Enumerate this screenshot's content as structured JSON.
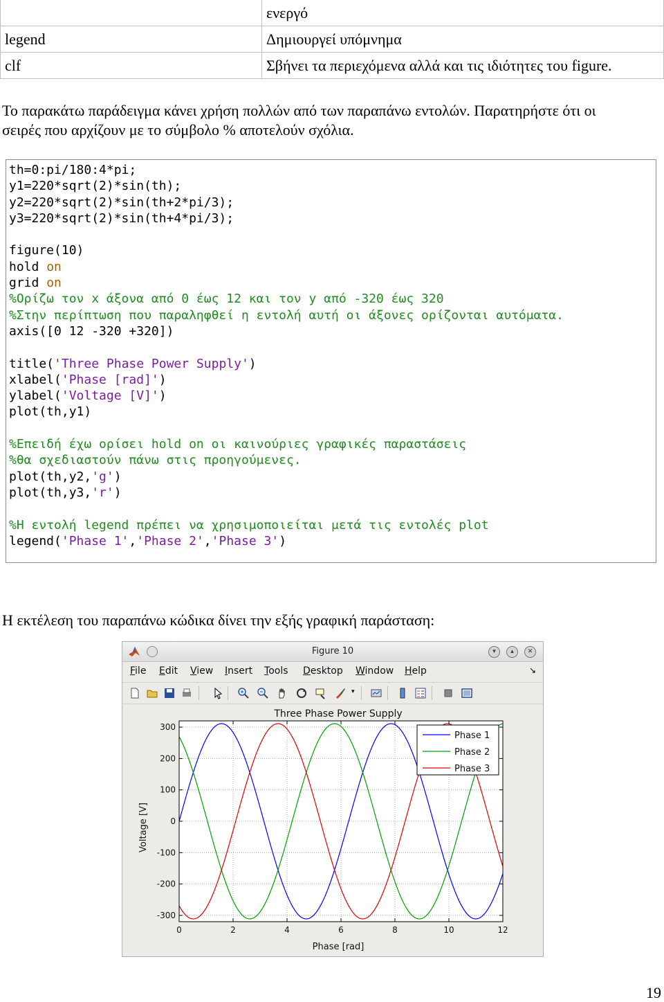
{
  "table": {
    "rows": [
      {
        "command": "",
        "description": "ενεργό"
      },
      {
        "command": "legend",
        "description": "Δημιουργεί υπόμνημα"
      },
      {
        "command": "clf",
        "description": "Σβήνει τα περιεχόμενα  αλλά και τις ιδιότητες του figure."
      }
    ]
  },
  "paragraph1_line1": "Το παρακάτω παράδειγμα κάνει χρήση πολλών από των παραπάνω εντολών. Παρατηρήστε ότι οι",
  "paragraph1_line2": "σειρές που αρχίζουν με  το σύμβολο % αποτελούν σχόλια.",
  "code": {
    "l1": "th=0:pi/180:4*pi;",
    "l2": "y1=220*sqrt(2)*sin(th);",
    "l3": "y2=220*sqrt(2)*sin(th+2*pi/3);",
    "l4": "y3=220*sqrt(2)*sin(th+4*pi/3);",
    "l5": "figure(10)",
    "hold": "hold ",
    "on": "on",
    "grid": "grid ",
    "c1": "%Ορίζω τον x άξονα από 0 έως 12 και τον y από -320 έως 320",
    "c2": "%Στην περίπτωση που παραληφθεί η εντολή αυτή οι άξονες ορίζονται αυτόματα.",
    "l6": "axis([0 12 -320 +320])",
    "title_fn": "title(",
    "title_str": "'Three Phase Power Supply'",
    "xlabel_fn": "xlabel(",
    "xlabel_str": "'Phase [rad]'",
    "ylabel_fn": "ylabel(",
    "ylabel_str": "'Voltage [V]'",
    "close": ")",
    "plot1": "plot(th,y1)",
    "c3": "%Επειδή έχω ορίσει hold on οι καινούριες γραφικές παραστάσεις",
    "c4": "%θα σχεδιαστούν πάνω στις προηγούμενες.",
    "plot2_fn": "plot(th,y2,",
    "plot2_str": "'g'",
    "plot3_fn": "plot(th,y3,",
    "plot3_str": "'r'",
    "c5": "%Η εντολή legend πρέπει να χρησιμοποιείται μετά τις εντολές plot",
    "legend_fn": "legend(",
    "leg_s1": "'Phase 1'",
    "leg_s2": "'Phase 2'",
    "leg_s3": "'Phase 3'",
    "comma": ","
  },
  "paragraph2": "Η εκτέλεση του παραπάνω κώδικα δίνει την εξής γραφική παράσταση:",
  "figure_window": {
    "title": "Figure 10",
    "menus": [
      "File",
      "Edit",
      "View",
      "Insert",
      "Tools",
      "Desktop",
      "Window",
      "Help"
    ],
    "toolbar_icons": [
      "new-file-icon",
      "open-folder-icon",
      "save-icon",
      "print-icon",
      "pointer-icon",
      "zoom-in-icon",
      "zoom-out-icon",
      "pan-icon",
      "rotate-icon",
      "data-cursor-icon",
      "brush-icon",
      "link-icon",
      "colorbar-icon",
      "legend-icon",
      "hide-tools-icon",
      "dock-icon"
    ]
  },
  "chart_data": {
    "type": "line",
    "title": "Three Phase Power Supply",
    "xlabel": "Phase [rad]",
    "ylabel": "Voltage [V]",
    "xlim": [
      0,
      12
    ],
    "ylim": [
      -320,
      320
    ],
    "xticks": [
      0,
      2,
      4,
      6,
      8,
      10,
      12
    ],
    "yticks": [
      300,
      200,
      100,
      0,
      -100,
      -200,
      -300
    ],
    "grid": true,
    "legend_position": "top-right",
    "amplitude": 311.13,
    "series": [
      {
        "name": "Phase 1",
        "color": "#0000ff",
        "phase_shift": 0
      },
      {
        "name": "Phase 2",
        "color": "#00a000",
        "phase_shift": 2.0944
      },
      {
        "name": "Phase 3",
        "color": "#e00000",
        "phase_shift": 4.1888
      }
    ]
  },
  "page_number": "19"
}
